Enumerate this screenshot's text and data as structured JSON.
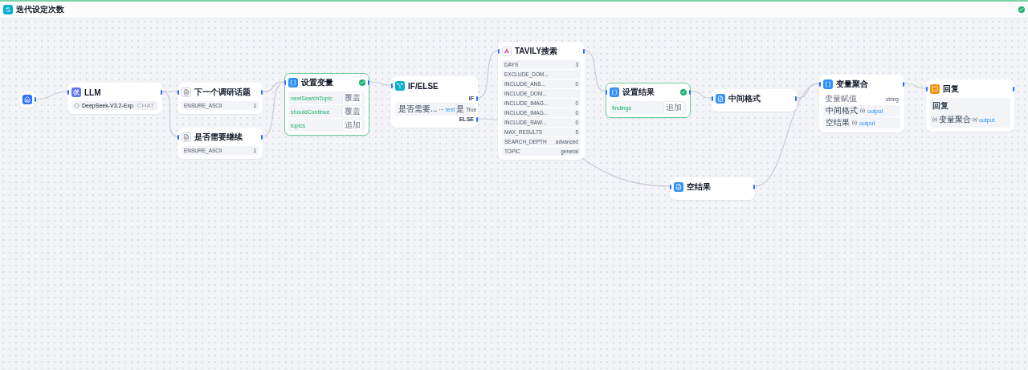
{
  "iteration": {
    "title": "迭代设定次数",
    "succeeded": true
  },
  "nodes": [
    {
      "kind": "start"
    },
    {
      "kind": "llm",
      "title": "LLM",
      "model": "DeepSeek-V3.2-Exp",
      "mode": "CHAT"
    },
    {
      "kind": "document",
      "title": "下一个调研话题",
      "params": [
        {
          "name": "ENSURE_ASCII",
          "value": "1"
        }
      ]
    },
    {
      "kind": "document",
      "title": "是否需要继续",
      "params": [
        {
          "name": "ENSURE_ASCII",
          "value": "1"
        }
      ]
    },
    {
      "kind": "assigner",
      "title": "设置变量",
      "assignments": [
        {
          "variable": "nextSearchTopic",
          "mode": "覆盖"
        },
        {
          "variable": "shouldContinue",
          "mode": "覆盖"
        },
        {
          "variable": "topics",
          "mode": "追加"
        }
      ],
      "succeeded": true
    },
    {
      "kind": "ifelse",
      "title": "IF/ELSE",
      "if_label": "IF",
      "condition": {
        "variable": "是否需要...",
        "operator": "···",
        "value": "text",
        "comparison": "是",
        "result": "True"
      },
      "else_label": "ELSE"
    },
    {
      "kind": "tool",
      "title": "TAVILY搜索",
      "params": [
        {
          "name": "DAYS",
          "value": "3"
        },
        {
          "name": "EXCLUDE_DOM..."
        },
        {
          "name": "INCLUDE_ANS...",
          "value": "0"
        },
        {
          "name": "INCLUDE_DOM..."
        },
        {
          "name": "INCLUDE_IMAG...",
          "value": "0"
        },
        {
          "name": "INCLUDE_IMAG...",
          "value": "0"
        },
        {
          "name": "INCLUDE_RAW...",
          "value": "0"
        },
        {
          "name": "MAX_RESULTS",
          "value": "5"
        },
        {
          "name": "SEARCH_DEPTH",
          "value": "advanced"
        },
        {
          "name": "TOPIC",
          "value": "general"
        }
      ]
    },
    {
      "kind": "assigner",
      "title": "设置结果",
      "assignments": [
        {
          "variable": "findings",
          "mode": "追加"
        }
      ],
      "succeeded": true
    },
    {
      "kind": "template",
      "title": "中间格式"
    },
    {
      "kind": "template",
      "title": "空结果"
    },
    {
      "kind": "aggregator",
      "title": "变量聚合",
      "group": "变量赋值",
      "type": "string",
      "inputs": [
        {
          "node": "中间格式",
          "variable": "output"
        },
        {
          "node": "空结果",
          "variable": "output"
        }
      ]
    },
    {
      "kind": "answer",
      "title": "回复",
      "label": "回复",
      "content": [
        {
          "node": "变量聚合",
          "variable": "output"
        }
      ]
    }
  ]
}
